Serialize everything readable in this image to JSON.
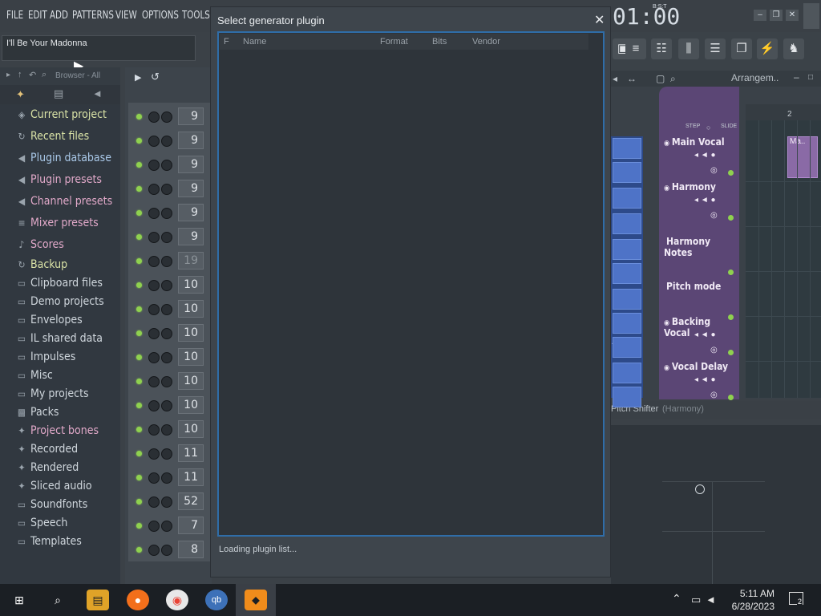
{
  "menu": {
    "file": "FILE",
    "edit": "EDIT",
    "add": "ADD",
    "patterns": "PATTERNS",
    "view": "VIEW",
    "options": "OPTIONS",
    "tools": "TOOLS"
  },
  "hint_bar": {
    "text": "I'll Be Your Madonna"
  },
  "clock_display": {
    "time": "01:00",
    "label": "B:S:T"
  },
  "browser": {
    "toolbar_label": "Browser - All",
    "items": [
      {
        "label": "Current project",
        "icon": "project-icon",
        "color": "#d9e2a6"
      },
      {
        "label": "Recent files",
        "icon": "recent-icon",
        "color": "#d9e2a6"
      },
      {
        "label": "Plugin database",
        "icon": "plug-icon",
        "color": "#a9c8e8"
      },
      {
        "label": "Plugin presets",
        "icon": "plug-icon",
        "color": "#e1a9c9"
      },
      {
        "label": "Channel presets",
        "icon": "channel-icon",
        "color": "#e1a9c9"
      },
      {
        "label": "Mixer presets",
        "icon": "mixer-icon",
        "color": "#e1a9c9"
      },
      {
        "label": "Scores",
        "icon": "note-icon",
        "color": "#e1a9c9"
      },
      {
        "label": "Backup",
        "icon": "backup-icon",
        "color": "#d9e2a6"
      },
      {
        "label": "Clipboard files",
        "icon": "folder-icon",
        "color": "#cfd6dc"
      },
      {
        "label": "Demo projects",
        "icon": "folder-icon",
        "color": "#cfd6dc"
      },
      {
        "label": "Envelopes",
        "icon": "folder-icon",
        "color": "#cfd6dc"
      },
      {
        "label": "IL shared data",
        "icon": "folder-icon",
        "color": "#cfd6dc"
      },
      {
        "label": "Impulses",
        "icon": "folder-icon",
        "color": "#cfd6dc"
      },
      {
        "label": "Misc",
        "icon": "folder-icon",
        "color": "#cfd6dc"
      },
      {
        "label": "My projects",
        "icon": "folder-icon",
        "color": "#cfd6dc"
      },
      {
        "label": "Packs",
        "icon": "pack-icon",
        "color": "#cfd6dc"
      },
      {
        "label": "Project bones",
        "icon": "bones-icon",
        "color": "#e1a9c9"
      },
      {
        "label": "Recorded",
        "icon": "recorded-icon",
        "color": "#cfd6dc"
      },
      {
        "label": "Rendered",
        "icon": "rendered-icon",
        "color": "#cfd6dc"
      },
      {
        "label": "Sliced audio",
        "icon": "sliced-icon",
        "color": "#cfd6dc"
      },
      {
        "label": "Soundfonts",
        "icon": "folder-icon",
        "color": "#cfd6dc"
      },
      {
        "label": "Speech",
        "icon": "folder-icon",
        "color": "#cfd6dc"
      },
      {
        "label": "Templates",
        "icon": "folder-icon",
        "color": "#cfd6dc"
      }
    ]
  },
  "channel_rack": {
    "values": [
      "9",
      "9",
      "9",
      "9",
      "9",
      "9",
      "19",
      "10",
      "10",
      "10",
      "10",
      "10",
      "10",
      "10",
      "11",
      "11",
      "52",
      "7",
      "8"
    ]
  },
  "dialog": {
    "title": "Select generator plugin",
    "columns": {
      "f": "F",
      "name": "Name",
      "format": "Format",
      "bits": "Bits",
      "vendor": "Vendor"
    },
    "status": "Loading plugin list..."
  },
  "playlist": {
    "arrangement_label": "Arrangem..",
    "bar_2": "2",
    "clip_label": "Ma..",
    "step_label": "STEP",
    "slide_label": "SLIDE",
    "tracks": [
      {
        "name": "Main Vocal"
      },
      {
        "name": "Harmony"
      },
      {
        "name": "Harmony Notes"
      },
      {
        "name": "Pitch mode"
      },
      {
        "name": "Backing Vocal"
      },
      {
        "name": "Vocal Delay"
      }
    ],
    "pattern_label": "?2",
    "pitch_shifter": {
      "name": "Pitch Shifter",
      "sub": "(Harmony)"
    }
  },
  "taskbar": {
    "time": "5:11 AM",
    "date": "6/28/2023",
    "notif_count": "2"
  }
}
